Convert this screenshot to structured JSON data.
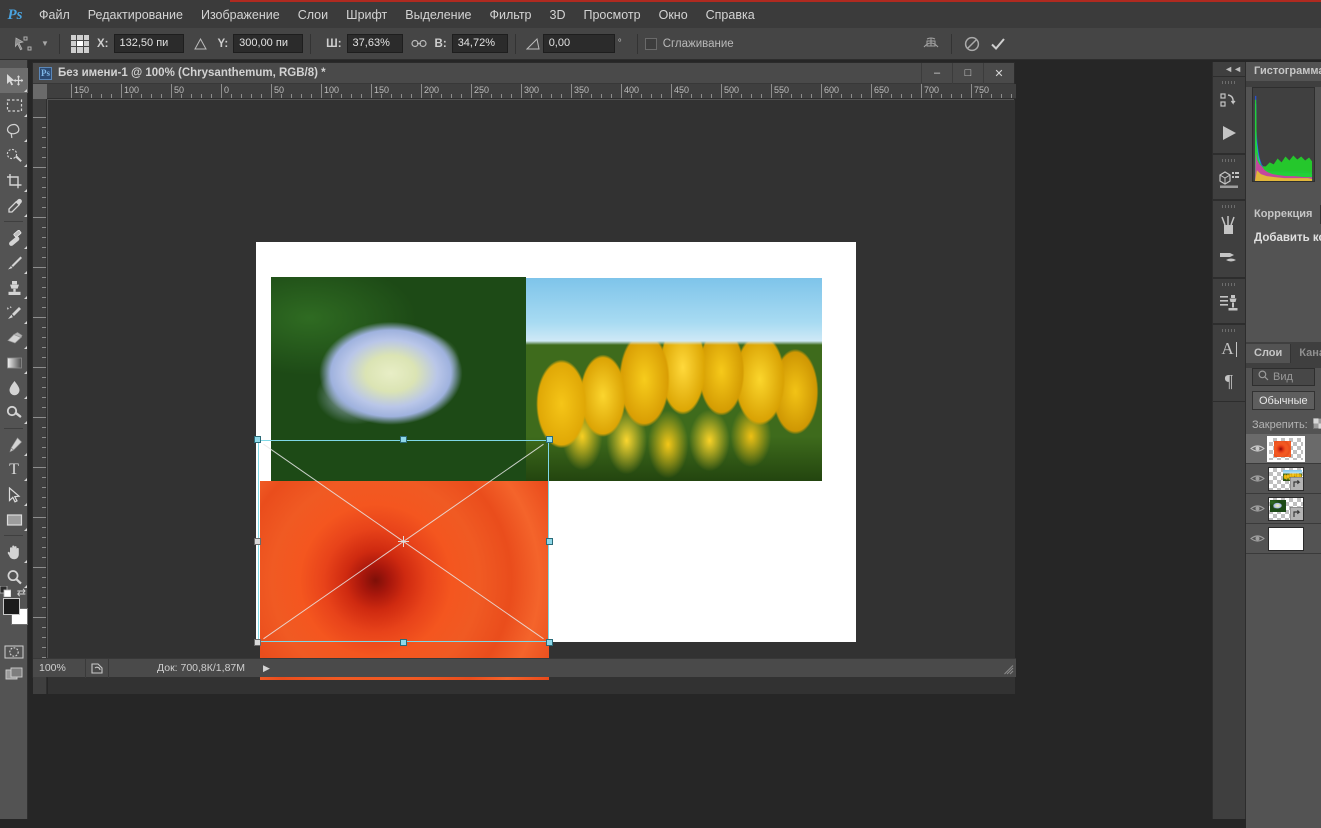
{
  "app": {
    "logo": "Ps"
  },
  "menubar": {
    "items": [
      "Файл",
      "Редактирование",
      "Изображение",
      "Слои",
      "Шрифт",
      "Выделение",
      "Фильтр",
      "3D",
      "Просмотр",
      "Окно",
      "Справка"
    ]
  },
  "options_bar": {
    "tool_icon": "free-transform-icon",
    "reference_point_icon": "reference-point-grid",
    "x_label": "X:",
    "x_value": "132,50 пи",
    "delta_icon_1": "delta-triangle",
    "y_label": "Y:",
    "y_value": "300,00 пи",
    "w_label": "Ш:",
    "w_value": "37,63%",
    "link_icon": "link-chain-icon",
    "h_label": "В:",
    "h_value": "34,72%",
    "angle_icon": "angle-triangle-icon",
    "angle_value": "0,00",
    "degree_symbol": "°",
    "antialias_label": "Сглаживание",
    "antialias_checked": false,
    "warp_icon": "warp-mode-icon",
    "cancel_icon": "cancel-transform-icon",
    "commit_icon": "commit-transform-icon"
  },
  "toolbar": {
    "tools": [
      {
        "name": "move-tool",
        "icon": "move-arrow-icon",
        "selected": true
      },
      {
        "name": "rectangular-marquee-tool",
        "icon": "marquee-dashed-rect-icon",
        "selected": false
      },
      {
        "name": "lasso-tool",
        "icon": "lasso-icon",
        "selected": false
      },
      {
        "name": "quick-selection-tool",
        "icon": "quick-selection-icon",
        "selected": false
      },
      {
        "name": "crop-tool",
        "icon": "crop-icon",
        "selected": false
      },
      {
        "name": "eyedropper-tool",
        "icon": "eyedropper-icon",
        "selected": false
      },
      {
        "name": "spot-healing-brush-tool",
        "icon": "healing-brush-icon",
        "selected": false
      },
      {
        "name": "brush-tool",
        "icon": "brush-icon",
        "selected": false
      },
      {
        "name": "clone-stamp-tool",
        "icon": "clone-stamp-icon",
        "selected": false
      },
      {
        "name": "history-brush-tool",
        "icon": "history-brush-icon",
        "selected": false
      },
      {
        "name": "eraser-tool",
        "icon": "eraser-icon",
        "selected": false
      },
      {
        "name": "gradient-tool",
        "icon": "gradient-icon",
        "selected": false
      },
      {
        "name": "blur-tool",
        "icon": "blur-droplet-icon",
        "selected": false
      },
      {
        "name": "dodge-tool",
        "icon": "dodge-icon",
        "selected": false
      },
      {
        "name": "pen-tool",
        "icon": "pen-icon",
        "selected": false
      },
      {
        "name": "type-tool",
        "icon": "type-T-icon",
        "selected": false
      },
      {
        "name": "path-selection-tool",
        "icon": "path-arrow-icon",
        "selected": false
      },
      {
        "name": "rectangle-shape-tool",
        "icon": "rectangle-shape-icon",
        "selected": false
      },
      {
        "name": "hand-tool",
        "icon": "hand-icon",
        "selected": false
      },
      {
        "name": "zoom-tool",
        "icon": "magnifier-icon",
        "selected": false
      }
    ],
    "foreground_color": "#1c1c1c",
    "background_color": "#ffffff",
    "swap_icon": "swap-colors-icon",
    "default_colors_icon": "default-colors-icon",
    "quick_mask_icon": "quick-mask-icon",
    "screen_mode_icon": "screen-mode-icon"
  },
  "document": {
    "title": "Без имени-1 @ 100% (Chrysanthemum, RGB/8) *",
    "window_buttons": {
      "minimize": "–",
      "maximize": "□",
      "close": "✕"
    },
    "ruler_h_ticks": [
      "150",
      "100",
      "50",
      "0",
      "50",
      "100",
      "150",
      "200",
      "250",
      "300",
      "350",
      "400",
      "450",
      "500",
      "550",
      "600",
      "650",
      "700",
      "750"
    ],
    "ruler_v_ticks": [
      "50",
      "0",
      "50",
      "100",
      "150",
      "200",
      "250",
      "300",
      "350",
      "400",
      "450"
    ],
    "images": [
      {
        "name": "hydrangea-layer-image",
        "alt": "Hydrangea"
      },
      {
        "name": "tulips-layer-image",
        "alt": "Tulips"
      },
      {
        "name": "chrysanthemum-layer-image",
        "alt": "Chrysanthemum"
      }
    ],
    "statusbar": {
      "zoom": "100%",
      "thumb_icon": "doc-preview-icon",
      "doc_info": "Док: 700,8К/1,87М",
      "arrow_icon": "status-expand-arrow"
    }
  },
  "icon_dock": {
    "collapse_icon": "collapse-panels-icon",
    "groups": [
      [
        "history-panel-icon",
        "actions-panel-icon"
      ],
      [
        "3d-panel-icon"
      ],
      [
        "brush-panel-icon",
        "brush-presets-panel-icon"
      ],
      [
        "clone-source-panel-icon"
      ],
      [
        "character-panel-icon",
        "paragraph-panel-icon"
      ]
    ]
  },
  "panels": {
    "histogram": {
      "tab": "Гистограмма"
    },
    "adjustments": {
      "tab": "Коррекция",
      "text": "Добавить ко"
    },
    "layers": {
      "tabs": [
        {
          "label": "Слои",
          "active": true
        },
        {
          "label": "Кана",
          "active": false
        }
      ],
      "search_placeholder": "Вид",
      "search_icon": "search-magnifier-icon",
      "blend_mode": "Обычные",
      "lock_label": "Закрепить:",
      "rows": [
        {
          "name": "layer-chrysanthemum",
          "visible": true,
          "selected": true,
          "thumb": "chrysanthemum"
        },
        {
          "name": "layer-tulips",
          "visible": true,
          "selected": false,
          "thumb": "tulips"
        },
        {
          "name": "layer-hydrangea",
          "visible": true,
          "selected": false,
          "thumb": "hydrangea"
        },
        {
          "name": "layer-background",
          "visible": true,
          "selected": false,
          "thumb": "white"
        }
      ]
    }
  },
  "colors": {
    "accent_red": "#b02a20",
    "chrome": "#3b3b3b",
    "panel": "#535353",
    "workspace": "#262626",
    "canvas": "#323232",
    "handle_cyan": "#8ed8e8"
  }
}
